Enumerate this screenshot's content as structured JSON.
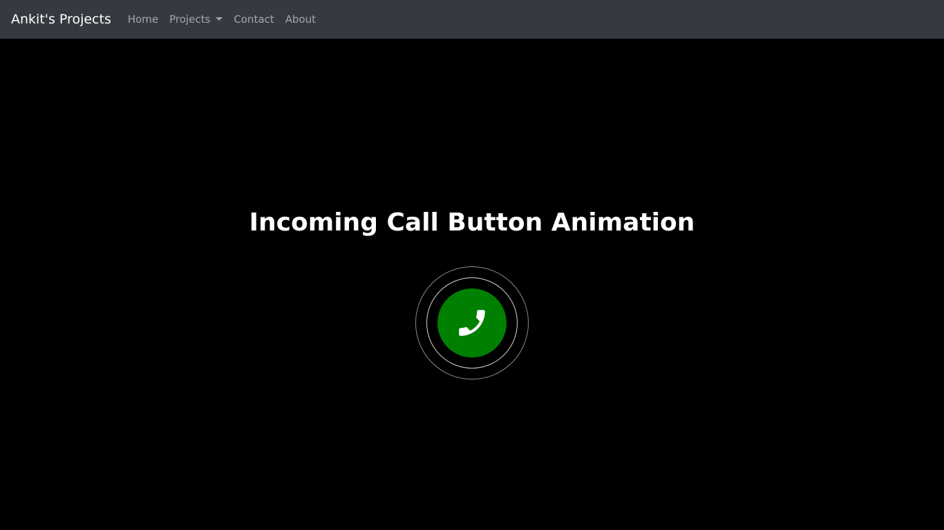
{
  "navbar": {
    "brand": "Ankit's Projects",
    "items": [
      {
        "label": "Home"
      },
      {
        "label": "Projects",
        "dropdown": true
      },
      {
        "label": "Contact"
      },
      {
        "label": "About"
      }
    ]
  },
  "main": {
    "title": "Incoming Call Button Animation",
    "call_button": {
      "icon": "phone-icon",
      "color": "#008000"
    }
  },
  "colors": {
    "navbar_bg": "#343a40",
    "page_bg": "#000000",
    "accent_green": "#008000"
  }
}
